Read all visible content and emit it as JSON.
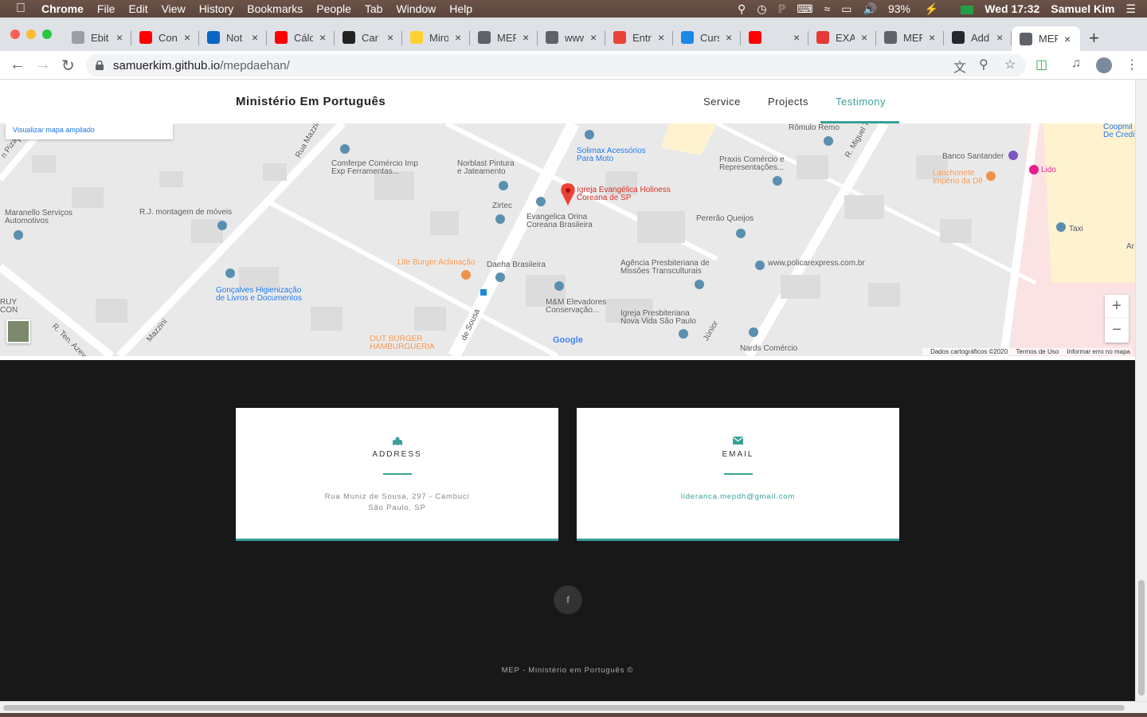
{
  "menubar": {
    "apple": "",
    "app": "Chrome",
    "items": [
      "File",
      "Edit",
      "View",
      "History",
      "Bookmarks",
      "People",
      "Tab",
      "Window",
      "Help"
    ],
    "battery": "93%",
    "datetime": "Wed 17:32",
    "user": "Samuel Kim"
  },
  "tabs": [
    {
      "label": "Ebit",
      "icon": "loading-icon",
      "color": "#9aa0a6"
    },
    {
      "label": "Con",
      "icon": "youtube-icon",
      "color": "#ff0000"
    },
    {
      "label": "Not",
      "icon": "linkedin-icon",
      "color": "#0a66c2"
    },
    {
      "label": "Cálc",
      "icon": "youtube-icon",
      "color": "#ff0000"
    },
    {
      "label": "Car",
      "icon": "amazon-icon",
      "color": "#222222"
    },
    {
      "label": "Miro",
      "icon": "miro-icon",
      "color": "#ffd02f"
    },
    {
      "label": "MEP",
      "icon": "globe-icon",
      "color": "#5f6368"
    },
    {
      "label": "www",
      "icon": "globe-icon",
      "color": "#5f6368"
    },
    {
      "label": "Entr",
      "icon": "gmail-icon",
      "color": "#ea4335"
    },
    {
      "label": "Curs",
      "icon": "course-icon",
      "color": "#1e88e5"
    },
    {
      "label": "",
      "icon": "youtube-icon",
      "color": "#ff0000"
    },
    {
      "label": "EXA",
      "icon": "exam-icon",
      "color": "#e53935"
    },
    {
      "label": "MEP",
      "icon": "globe-icon",
      "color": "#5f6368"
    },
    {
      "label": "Add",
      "icon": "github-icon",
      "color": "#24292e"
    },
    {
      "label": "MEP",
      "icon": "globe-icon",
      "color": "#5f6368",
      "active": true
    }
  ],
  "address": {
    "host": "samuerkim.github.io",
    "path": "/mepdaehan/"
  },
  "site": {
    "brand": "Ministério Em Português",
    "nav": [
      {
        "label": "Service",
        "active": false
      },
      {
        "label": "Projects",
        "active": false
      },
      {
        "label": "Testimony",
        "active": true
      }
    ],
    "accent": "#3aa199"
  },
  "map": {
    "link": "Visualizar mapa ampliado",
    "zoom_in": "+",
    "zoom_out": "−",
    "logo": "Google",
    "footer": [
      "Dados cartográficos ©2020",
      "Termos de Uso",
      "Informar erro no mapa"
    ],
    "place": "Igreja Evangélica Holiness Coreana de SP",
    "labels": [
      "Solimax Acessórios Para Moto",
      "Rômulo Remo",
      "Comferpe Comércio Imp Exp Ferramentas...",
      "Norblast Pintura e Jateamento",
      "Praxis Comércio e Representações...",
      "Banco Santander",
      "Lanchonete Império da Dê",
      "Lido",
      "Maranello Serviços Automotivos",
      "R.J. montagem de móveis",
      "Zirtec",
      "Evangelica Orina Coreana Brasileira",
      "Pererão Queijos",
      "Taxi",
      "Life Burger Aclimação",
      "Daeha Brasileira",
      "Agência Presbiteriana de Missões Transculturais",
      "www.policarexpress.com.br",
      "Gonçalves Higienização de Livros e Documentos",
      "M&M Elevadores Conservação...",
      "Igreja Presbiteriana Nova Vida São Paulo",
      "OUT BURGER HAMBURGUERIA",
      "Nards Comércio",
      "Rua Mazzini",
      "R. Ten. Azevedo",
      "R. Miguel Te",
      "de Sousa",
      "Júnior",
      "Mazzini",
      "Coopmil De Credi",
      "Ar",
      "RUY CON",
      "n Piza",
      "R. J"
    ]
  },
  "contact": {
    "address": {
      "title": "ADDRESS",
      "line1": "Rua Muniz de Sousa, 297 - Cambuci",
      "line2": "São Paulo, SP"
    },
    "email": {
      "title": "EMAIL",
      "value": "lideranca.mepdh@gmail.com"
    }
  },
  "social": {
    "facebook": "f"
  },
  "copyright": "MEP - Ministério em Português ©"
}
